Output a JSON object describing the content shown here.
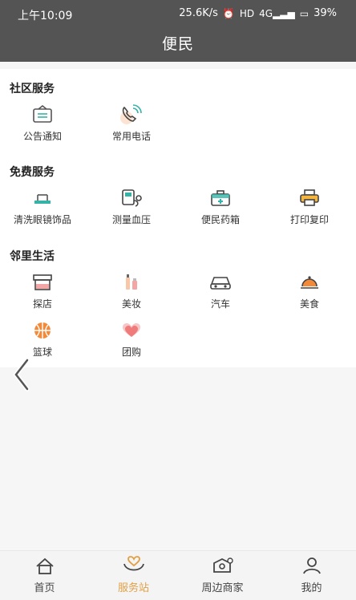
{
  "status_bar": {
    "time": "上午10:09",
    "speed": "25.6K/s",
    "battery": "39%",
    "signal": "4G"
  },
  "header": {
    "title": "便民"
  },
  "sections": [
    {
      "title": "社区服务",
      "items": [
        {
          "label": "公告通知",
          "icon": "notice-icon"
        },
        {
          "label": "常用电话",
          "icon": "phone-icon"
        }
      ]
    },
    {
      "title": "免费服务",
      "items": [
        {
          "label": "清洗眼镜饰品",
          "icon": "glasses-clean-icon"
        },
        {
          "label": "测量血压",
          "icon": "blood-pressure-icon"
        },
        {
          "label": "便民药箱",
          "icon": "medicine-box-icon"
        },
        {
          "label": "打印复印",
          "icon": "printer-icon"
        }
      ]
    },
    {
      "title": "邻里生活",
      "items": [
        {
          "label": "探店",
          "icon": "shop-icon"
        },
        {
          "label": "美妆",
          "icon": "cosmetics-icon"
        },
        {
          "label": "汽车",
          "icon": "car-icon"
        },
        {
          "label": "美食",
          "icon": "food-icon"
        },
        {
          "label": "篮球",
          "icon": "basketball-icon"
        },
        {
          "label": "团购",
          "icon": "group-buy-icon"
        }
      ]
    }
  ],
  "bottom_nav": [
    {
      "label": "首页",
      "icon": "home-icon",
      "active": false
    },
    {
      "label": "服务站",
      "icon": "service-station-icon",
      "active": true
    },
    {
      "label": "周边商家",
      "icon": "nearby-shops-icon",
      "active": false
    },
    {
      "label": "我的",
      "icon": "profile-icon",
      "active": false
    }
  ],
  "colors": {
    "accent": "#e2a046",
    "header_bg": "#545454",
    "teal": "#35b3a6",
    "orange": "#f28a3a",
    "pink": "#f3a0a0"
  }
}
